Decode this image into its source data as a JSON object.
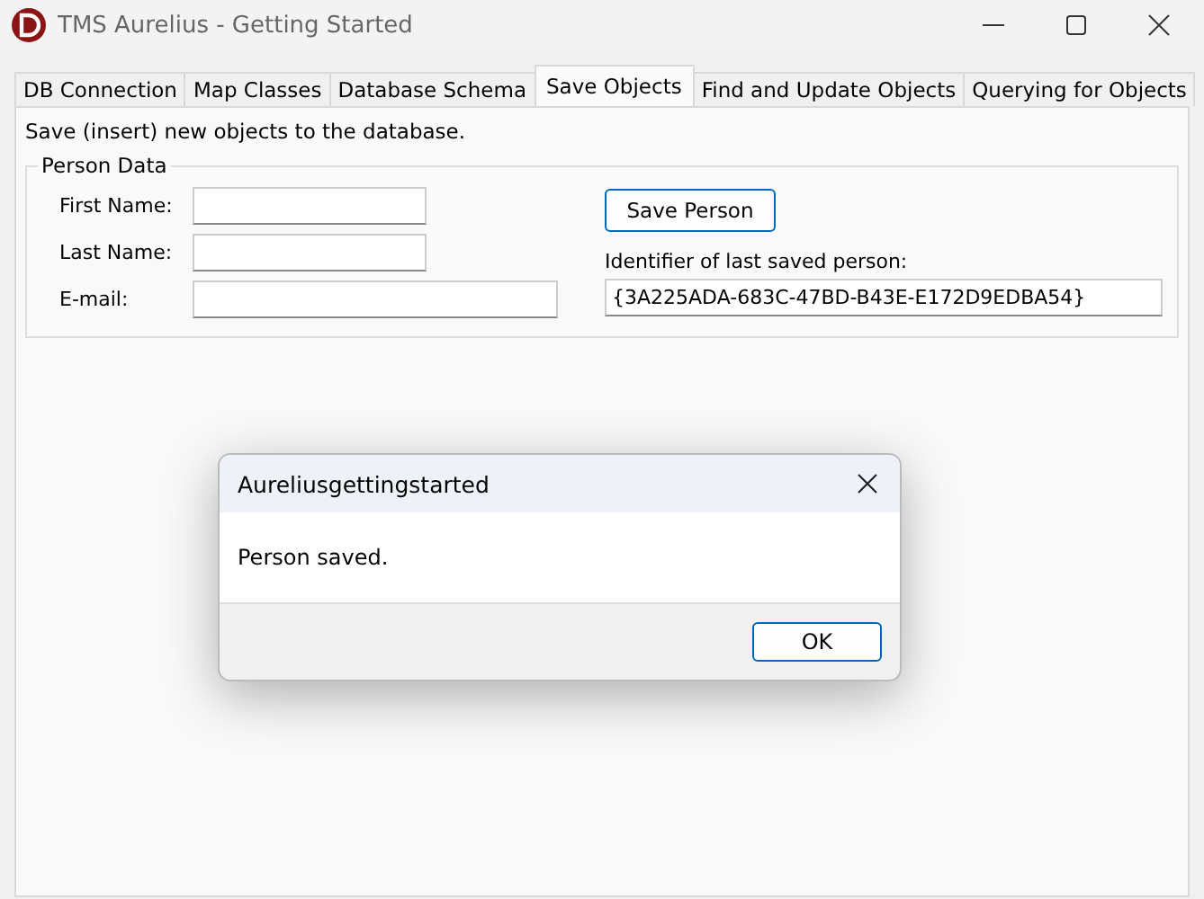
{
  "window": {
    "title": "TMS Aurelius - Getting Started"
  },
  "tabs": [
    {
      "label": "DB Connection",
      "selected": false
    },
    {
      "label": "Map Classes",
      "selected": false
    },
    {
      "label": "Database Schema",
      "selected": false
    },
    {
      "label": "Save Objects",
      "selected": true
    },
    {
      "label": "Find and Update Objects",
      "selected": false
    },
    {
      "label": "Querying for Objects",
      "selected": false
    }
  ],
  "description": "Save (insert) new objects to the database.",
  "group": {
    "title": "Person Data",
    "fields": [
      {
        "label": "First Name:"
      },
      {
        "label": "Last Name:"
      },
      {
        "label": "E-mail:"
      }
    ],
    "save_button": "Save Person",
    "identifier_label": "Identifier of last saved person:",
    "identifier_value": "{3A225ADA-683C-47BD-B43E-E172D9EDBA54}"
  },
  "dialog": {
    "title": "Aureliusgettingstarted",
    "message": "Person saved.",
    "buttons": [
      "OK"
    ]
  }
}
